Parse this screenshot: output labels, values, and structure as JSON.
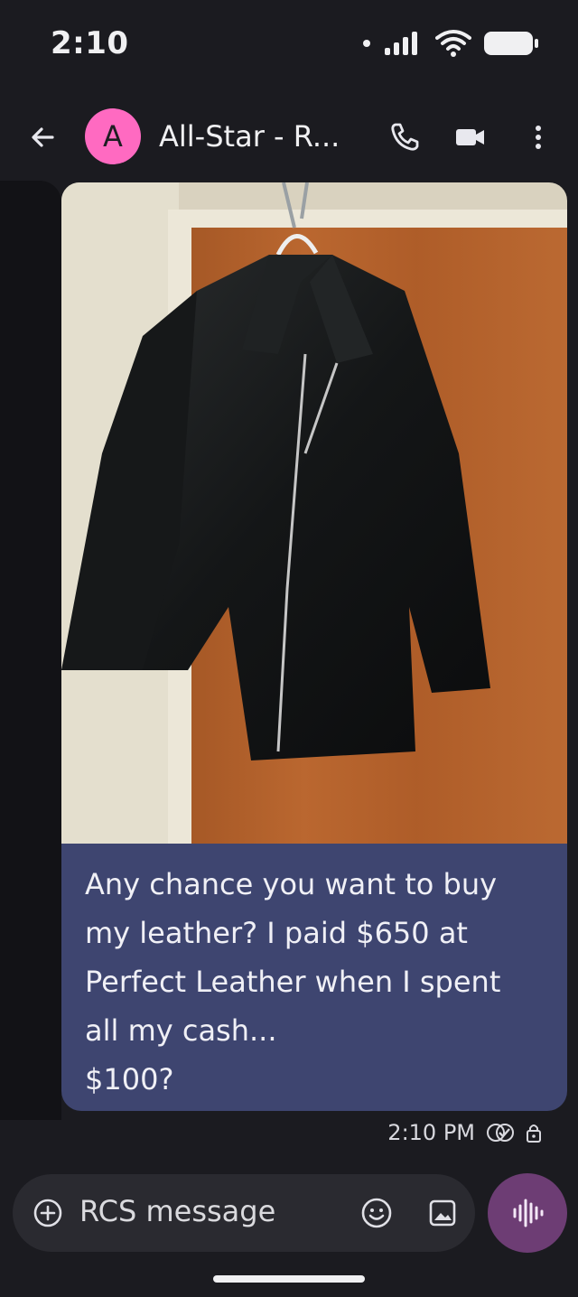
{
  "status_bar": {
    "time": "2:10"
  },
  "header": {
    "avatar_letter": "A",
    "contact_name": "All-Star - R..."
  },
  "message": {
    "text": "Any chance you want to buy\nmy leather?  I paid $650 at\nPerfect Leather when I spent\nall my cash...\n$100?",
    "timestamp": "2:10 PM"
  },
  "composer": {
    "placeholder": "RCS message"
  },
  "icons": {
    "back": "arrow-left-icon",
    "call": "phone-icon",
    "video": "video-camera-icon",
    "more": "more-vertical-icon",
    "attach": "plus-circle-icon",
    "emoji": "emoji-icon",
    "gallery": "image-icon",
    "voice": "voice-waveform-icon",
    "read_receipt": "double-check-icon",
    "lock": "lock-icon"
  },
  "colors": {
    "background": "#1b1b20",
    "bubble": "#3e4570",
    "avatar": "#ff6ac1",
    "voice_button": "#6d3d74"
  }
}
